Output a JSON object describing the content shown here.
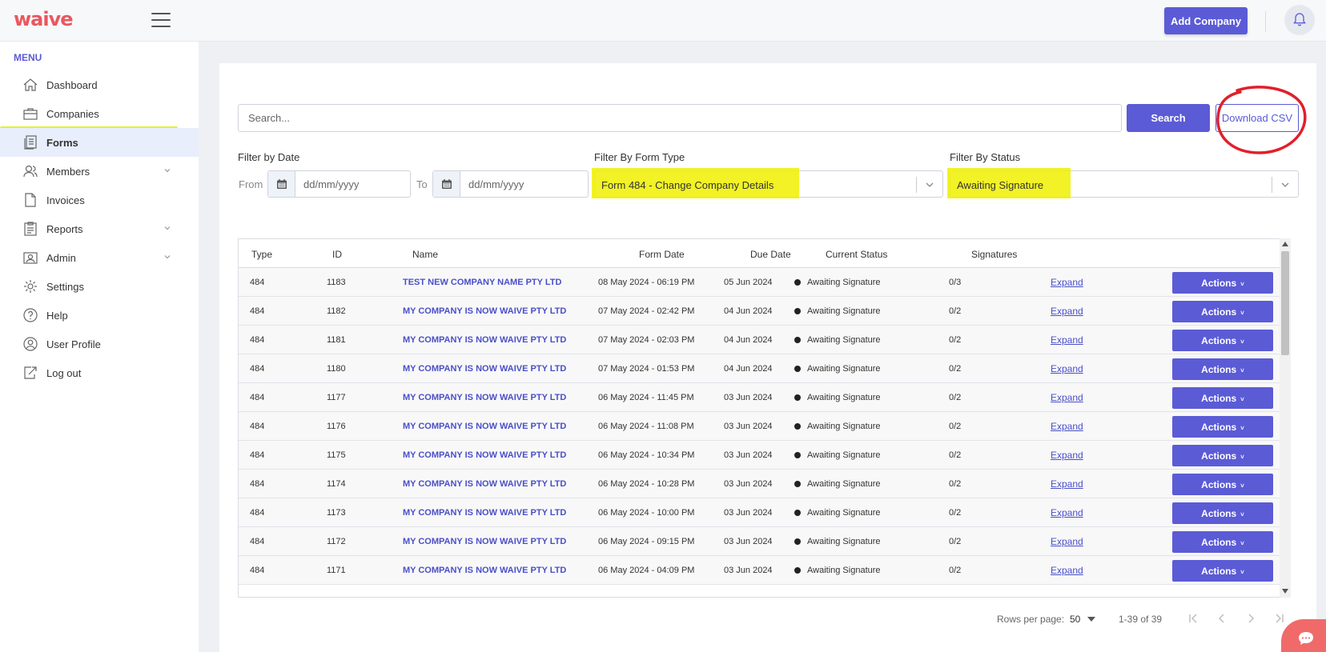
{
  "app": {
    "logo_text": "waive"
  },
  "header": {
    "add_company_label": "Add Company"
  },
  "sidebar": {
    "heading": "MENU",
    "items": [
      {
        "label": "Dashboard",
        "icon": "home-icon",
        "has_chevron": false
      },
      {
        "label": "Companies",
        "icon": "briefcase-icon",
        "has_chevron": false
      },
      {
        "label": "Forms",
        "icon": "forms-icon",
        "has_chevron": false,
        "active": true
      },
      {
        "label": "Members",
        "icon": "members-icon",
        "has_chevron": true
      },
      {
        "label": "Invoices",
        "icon": "document-icon",
        "has_chevron": false
      },
      {
        "label": "Reports",
        "icon": "clipboard-icon",
        "has_chevron": true
      },
      {
        "label": "Admin",
        "icon": "admin-icon",
        "has_chevron": true
      },
      {
        "label": "Settings",
        "icon": "gear-icon",
        "has_chevron": false
      },
      {
        "label": "Help",
        "icon": "help-icon",
        "has_chevron": false
      },
      {
        "label": "User Profile",
        "icon": "user-icon",
        "has_chevron": false
      },
      {
        "label": "Log out",
        "icon": "logout-icon",
        "has_chevron": false
      }
    ]
  },
  "search": {
    "placeholder": "Search...",
    "button_label": "Search",
    "csv_label": "Download CSV"
  },
  "filters": {
    "date_label": "Filter by Date",
    "from_label": "From",
    "to_label": "To",
    "date_placeholder": "dd/mm/yyyy",
    "form_type_label": "Filter By Form Type",
    "form_type_value": "Form 484 - Change Company Details",
    "status_label": "Filter By Status",
    "status_value": "Awaiting Signature"
  },
  "table": {
    "headers": [
      "Type",
      "ID",
      "Name",
      "Form Date",
      "Due Date",
      "Current Status",
      "Signatures"
    ],
    "expand_label": "Expand",
    "actions_label": "Actions",
    "rows": [
      {
        "type": "484",
        "id": "1183",
        "name": "TEST NEW COMPANY NAME PTY LTD",
        "form_date": "08 May 2024 - 06:19 PM",
        "due_date": "05 Jun 2024",
        "status": "Awaiting Signature",
        "signatures": "0/3"
      },
      {
        "type": "484",
        "id": "1182",
        "name": "MY COMPANY IS NOW WAIVE PTY LTD",
        "form_date": "07 May 2024 - 02:42 PM",
        "due_date": "04 Jun 2024",
        "status": "Awaiting Signature",
        "signatures": "0/2"
      },
      {
        "type": "484",
        "id": "1181",
        "name": "MY COMPANY IS NOW WAIVE PTY LTD",
        "form_date": "07 May 2024 - 02:03 PM",
        "due_date": "04 Jun 2024",
        "status": "Awaiting Signature",
        "signatures": "0/2"
      },
      {
        "type": "484",
        "id": "1180",
        "name": "MY COMPANY IS NOW WAIVE PTY LTD",
        "form_date": "07 May 2024 - 01:53 PM",
        "due_date": "04 Jun 2024",
        "status": "Awaiting Signature",
        "signatures": "0/2"
      },
      {
        "type": "484",
        "id": "1177",
        "name": "MY COMPANY IS NOW WAIVE PTY LTD",
        "form_date": "06 May 2024 - 11:45 PM",
        "due_date": "03 Jun 2024",
        "status": "Awaiting Signature",
        "signatures": "0/2"
      },
      {
        "type": "484",
        "id": "1176",
        "name": "MY COMPANY IS NOW WAIVE PTY LTD",
        "form_date": "06 May 2024 - 11:08 PM",
        "due_date": "03 Jun 2024",
        "status": "Awaiting Signature",
        "signatures": "0/2"
      },
      {
        "type": "484",
        "id": "1175",
        "name": "MY COMPANY IS NOW WAIVE PTY LTD",
        "form_date": "06 May 2024 - 10:34 PM",
        "due_date": "03 Jun 2024",
        "status": "Awaiting Signature",
        "signatures": "0/2"
      },
      {
        "type": "484",
        "id": "1174",
        "name": "MY COMPANY IS NOW WAIVE PTY LTD",
        "form_date": "06 May 2024 - 10:28 PM",
        "due_date": "03 Jun 2024",
        "status": "Awaiting Signature",
        "signatures": "0/2"
      },
      {
        "type": "484",
        "id": "1173",
        "name": "MY COMPANY IS NOW WAIVE PTY LTD",
        "form_date": "06 May 2024 - 10:00 PM",
        "due_date": "03 Jun 2024",
        "status": "Awaiting Signature",
        "signatures": "0/2"
      },
      {
        "type": "484",
        "id": "1172",
        "name": "MY COMPANY IS NOW WAIVE PTY LTD",
        "form_date": "06 May 2024 - 09:15 PM",
        "due_date": "03 Jun 2024",
        "status": "Awaiting Signature",
        "signatures": "0/2"
      },
      {
        "type": "484",
        "id": "1171",
        "name": "MY COMPANY IS NOW WAIVE PTY LTD",
        "form_date": "06 May 2024 - 04:09 PM",
        "due_date": "03 Jun 2024",
        "status": "Awaiting Signature",
        "signatures": "0/2"
      }
    ]
  },
  "pagination": {
    "rows_per_page_label": "Rows per page:",
    "rows_per_page_value": "50",
    "range": "1-39 of 39"
  },
  "colors": {
    "accent": "#5b5bd6",
    "logo": "#e8585f",
    "highlight": "#e1ef00",
    "annotation_circle": "#e0202a"
  }
}
